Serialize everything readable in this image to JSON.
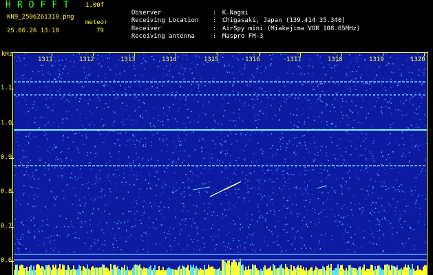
{
  "header": {
    "brand": "HROFFT",
    "version": "1.00f",
    "filename": "KN9_2506261310.png",
    "mode": "meteor",
    "timestamp": "25.06.26 13:10",
    "count": "79"
  },
  "info": [
    {
      "key": "Observer",
      "value": "K.Nagai"
    },
    {
      "key": "Receiving Location",
      "value": "Chigasaki, Japan (139.414 35.340)"
    },
    {
      "key": "Receiver",
      "value": "AirSpy mini (Miakejima VOR 108.65MHz)"
    },
    {
      "key": "Receiving antenna",
      "value": "Maspro FM-3"
    }
  ],
  "plot": {
    "y_units": "kHz",
    "y_ticks": [
      "1.1",
      "1.0",
      "0.9",
      "0.8",
      "0.7",
      "0.6"
    ],
    "x_ticks": [
      "1311",
      "1312",
      "1313",
      "1314",
      "1315",
      "1316",
      "1317",
      "1318",
      "1319",
      "1320"
    ],
    "colors": {
      "background": "#0c1aa0",
      "axis": "#ffff40",
      "brand": "#3cff3c",
      "trace": "#80e0ff"
    }
  }
}
